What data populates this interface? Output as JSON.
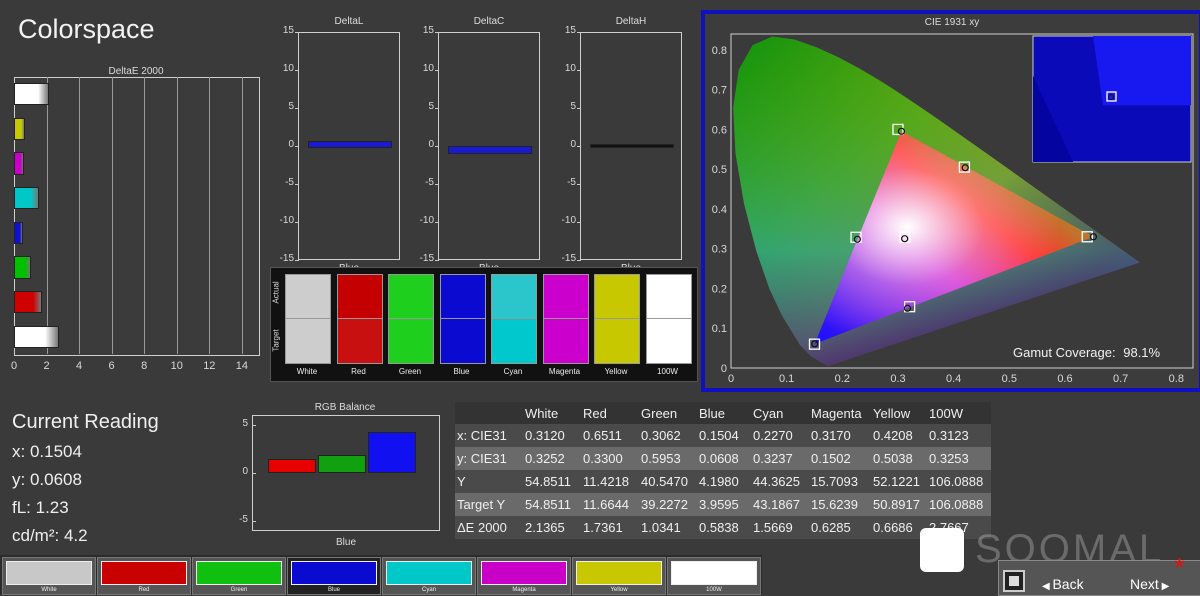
{
  "app_title": "Colorspace",
  "deltae": {
    "title": "DeltaE 2000",
    "x_ticks": [
      "0",
      "2",
      "4",
      "6",
      "8",
      "10",
      "12",
      "14"
    ],
    "bars": [
      {
        "name": "White",
        "value": 2.1365,
        "color": "#ffffff"
      },
      {
        "name": "Yellow",
        "value": 0.6686,
        "color": "#c8c800"
      },
      {
        "name": "Magenta",
        "value": 0.6285,
        "color": "#c800c8"
      },
      {
        "name": "Cyan",
        "value": 1.5669,
        "color": "#00c8c8"
      },
      {
        "name": "Blue",
        "value": 0.5838,
        "color": "#1010d0"
      },
      {
        "name": "Green",
        "value": 1.0341,
        "color": "#00c000"
      },
      {
        "name": "Red",
        "value": 1.7361,
        "color": "#d00000"
      },
      {
        "name": "100W",
        "value": 2.7667,
        "color": "#ffffff"
      }
    ]
  },
  "delta_charts": [
    {
      "title": "DeltaL",
      "xlabel": "Blue",
      "value": 0.6,
      "color": "#1a1ad0"
    },
    {
      "title": "DeltaC",
      "xlabel": "Blue",
      "value": -0.8,
      "color": "#1a1ad0"
    },
    {
      "title": "DeltaH",
      "xlabel": "Blue",
      "value": 0.1,
      "color": "#111111"
    }
  ],
  "delta_ticks": [
    "15",
    "10",
    "5",
    "0",
    "-5",
    "-10",
    "-15"
  ],
  "patches": {
    "actual_label": "Actual",
    "target_label": "Target",
    "items": [
      {
        "label": "White",
        "actual": "#cdcdcd",
        "target": "#cdcdcd"
      },
      {
        "label": "Red",
        "actual": "#c40000",
        "target": "#c81010"
      },
      {
        "label": "Green",
        "actual": "#1ecf1e",
        "target": "#1ecf1e"
      },
      {
        "label": "Blue",
        "actual": "#0a0ad0",
        "target": "#0a0ad0"
      },
      {
        "label": "Cyan",
        "actual": "#2bc6cc",
        "target": "#00c8cc"
      },
      {
        "label": "Magenta",
        "actual": "#cc00cc",
        "target": "#cc00cc"
      },
      {
        "label": "Yellow",
        "actual": "#c8c800",
        "target": "#c8c800"
      },
      {
        "label": "100W",
        "actual": "#ffffff",
        "target": "#ffffff"
      }
    ]
  },
  "cie": {
    "title": "CIE 1931 xy",
    "x_ticks": [
      "0",
      "0.1",
      "0.2",
      "0.3",
      "0.4",
      "0.5",
      "0.6",
      "0.7",
      "0.8"
    ],
    "y_ticks": [
      "0.8",
      "0.7",
      "0.6",
      "0.5",
      "0.4",
      "0.3",
      "0.2",
      "0.1",
      "0"
    ],
    "gamut_label": "Gamut Coverage:",
    "gamut_value": "98.1%",
    "targets": [
      {
        "name": "White",
        "x": 0.3127,
        "y": 0.329
      },
      {
        "name": "Red",
        "x": 0.64,
        "y": 0.33
      },
      {
        "name": "Green",
        "x": 0.3,
        "y": 0.6
      },
      {
        "name": "Blue",
        "x": 0.15,
        "y": 0.06
      },
      {
        "name": "Cyan",
        "x": 0.2246,
        "y": 0.3287
      },
      {
        "name": "Magenta",
        "x": 0.3209,
        "y": 0.1542
      },
      {
        "name": "Yellow",
        "x": 0.4193,
        "y": 0.5053
      }
    ],
    "measured": [
      {
        "name": "White",
        "x": 0.312,
        "y": 0.3252
      },
      {
        "name": "Red",
        "x": 0.6511,
        "y": 0.33
      },
      {
        "name": "Green",
        "x": 0.3062,
        "y": 0.5953
      },
      {
        "name": "Blue",
        "x": 0.1504,
        "y": 0.0608
      },
      {
        "name": "Cyan",
        "x": 0.227,
        "y": 0.3237
      },
      {
        "name": "Magenta",
        "x": 0.317,
        "y": 0.1502
      },
      {
        "name": "Yellow",
        "x": 0.4208,
        "y": 0.5038
      }
    ]
  },
  "current_reading": {
    "title": "Current Reading",
    "x": "x: 0.1504",
    "y": "y: 0.0608",
    "fl": "fL: 1.23",
    "cdm2": "cd/m²: 4.2"
  },
  "rgb_balance": {
    "title": "RGB Balance",
    "y_ticks": [
      "5",
      "0",
      "-5"
    ],
    "xlabel": "Blue",
    "values": [
      {
        "name": "Red",
        "value": 1.4,
        "color": "#e80000"
      },
      {
        "name": "Green",
        "value": 1.9,
        "color": "#10a010"
      },
      {
        "name": "Blue",
        "value": 4.2,
        "color": "#1010f0"
      }
    ]
  },
  "table": {
    "headers": [
      "",
      "White",
      "Red",
      "Green",
      "Blue",
      "Cyan",
      "Magenta",
      "Yellow",
      "100W"
    ],
    "rows": [
      [
        "x: CIE31",
        "0.3120",
        "0.6511",
        "0.3062",
        "0.1504",
        "0.2270",
        "0.3170",
        "0.4208",
        "0.3123"
      ],
      [
        "y: CIE31",
        "0.3252",
        "0.3300",
        "0.5953",
        "0.0608",
        "0.3237",
        "0.1502",
        "0.5038",
        "0.3253"
      ],
      [
        "Y",
        "54.8511",
        "11.4218",
        "40.5470",
        "4.1980",
        "44.3625",
        "15.7093",
        "52.1221",
        "106.0888"
      ],
      [
        "Target Y",
        "54.8511",
        "11.6644",
        "39.2272",
        "3.9595",
        "43.1867",
        "15.6239",
        "50.8917",
        "106.0888"
      ],
      [
        "ΔE 2000",
        "2.1365",
        "1.7361",
        "1.0341",
        "0.5838",
        "1.5669",
        "0.6285",
        "0.6686",
        "2.7667"
      ]
    ]
  },
  "bottom_swatches": [
    {
      "label": "White",
      "color": "#c8c8c8"
    },
    {
      "label": "Red",
      "color": "#c80000"
    },
    {
      "label": "Green",
      "color": "#10c010"
    },
    {
      "label": "Blue",
      "color": "#0a0ad0"
    },
    {
      "label": "Cyan",
      "color": "#00c8c8"
    },
    {
      "label": "Magenta",
      "color": "#c800c8"
    },
    {
      "label": "Yellow",
      "color": "#c8c800"
    },
    {
      "label": "100W",
      "color": "#ffffff"
    }
  ],
  "nav": {
    "back": "Back",
    "next": "Next"
  },
  "watermark": "SOOMAL"
}
